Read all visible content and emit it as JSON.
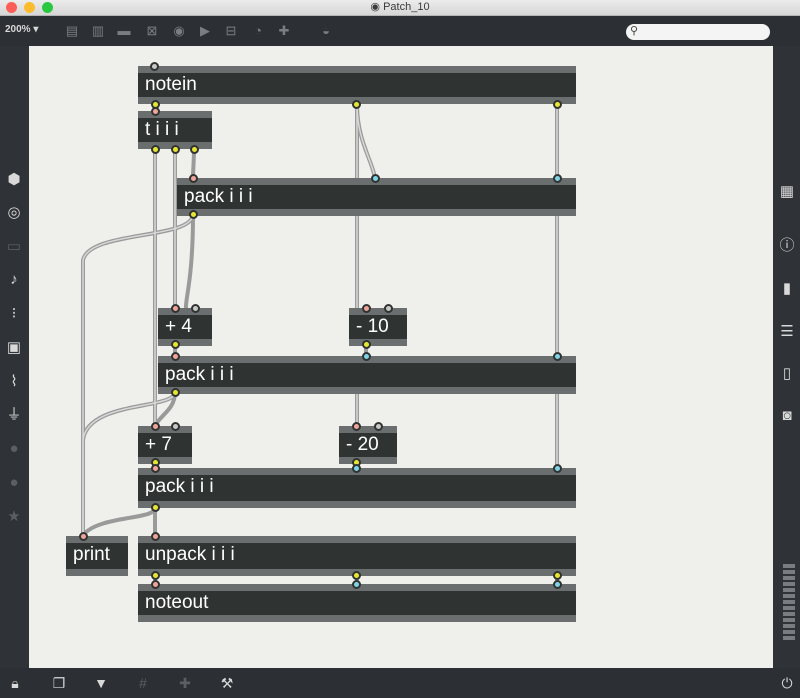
{
  "window": {
    "title": "Patch_10"
  },
  "toolbar": {
    "zoom_label": "200% ▾",
    "icons": [
      "presentation-icon",
      "comment-icon",
      "message-icon",
      "toggle-icon",
      "button-icon",
      "playbar-icon",
      "slider-icon",
      "dial-icon",
      "new-object-icon",
      "paint-bucket-icon"
    ],
    "search_placeholder": ""
  },
  "left_sidebar": [
    "package-icon",
    "target-icon",
    "media-icon",
    "music-note-icon",
    "sequencer-icon",
    "image-icon",
    "paperclip-icon",
    "plug-icon",
    "help-circle-icon",
    "info-circle-icon",
    "star-icon"
  ],
  "right_sidebar": [
    "grid-icon",
    "info-icon",
    "book-icon",
    "list-icon",
    "reference-icon",
    "snapshot-icon"
  ],
  "objects": {
    "notein": "notein",
    "trigger": "t i i i",
    "pack1": "pack i i i",
    "plus4": "+ 4",
    "minus10": "- 10",
    "pack2": "pack i i i",
    "plus7": "+ 7",
    "minus20": "- 20",
    "pack3": "pack i i i",
    "print": "print",
    "unpack": "unpack i i i",
    "noteout": "noteout"
  },
  "bottom_bar": [
    "lock-icon",
    "window-icon",
    "presentation-icon",
    "grid-icon",
    "add-object-icon",
    "wrench-icon",
    "power-icon"
  ],
  "colors": {
    "canvas": "#efefeb",
    "object": "#2f3331",
    "outlet": "#e6e632",
    "inlet": "#f0a49a",
    "cold_inlet": "#7fd3e6"
  }
}
